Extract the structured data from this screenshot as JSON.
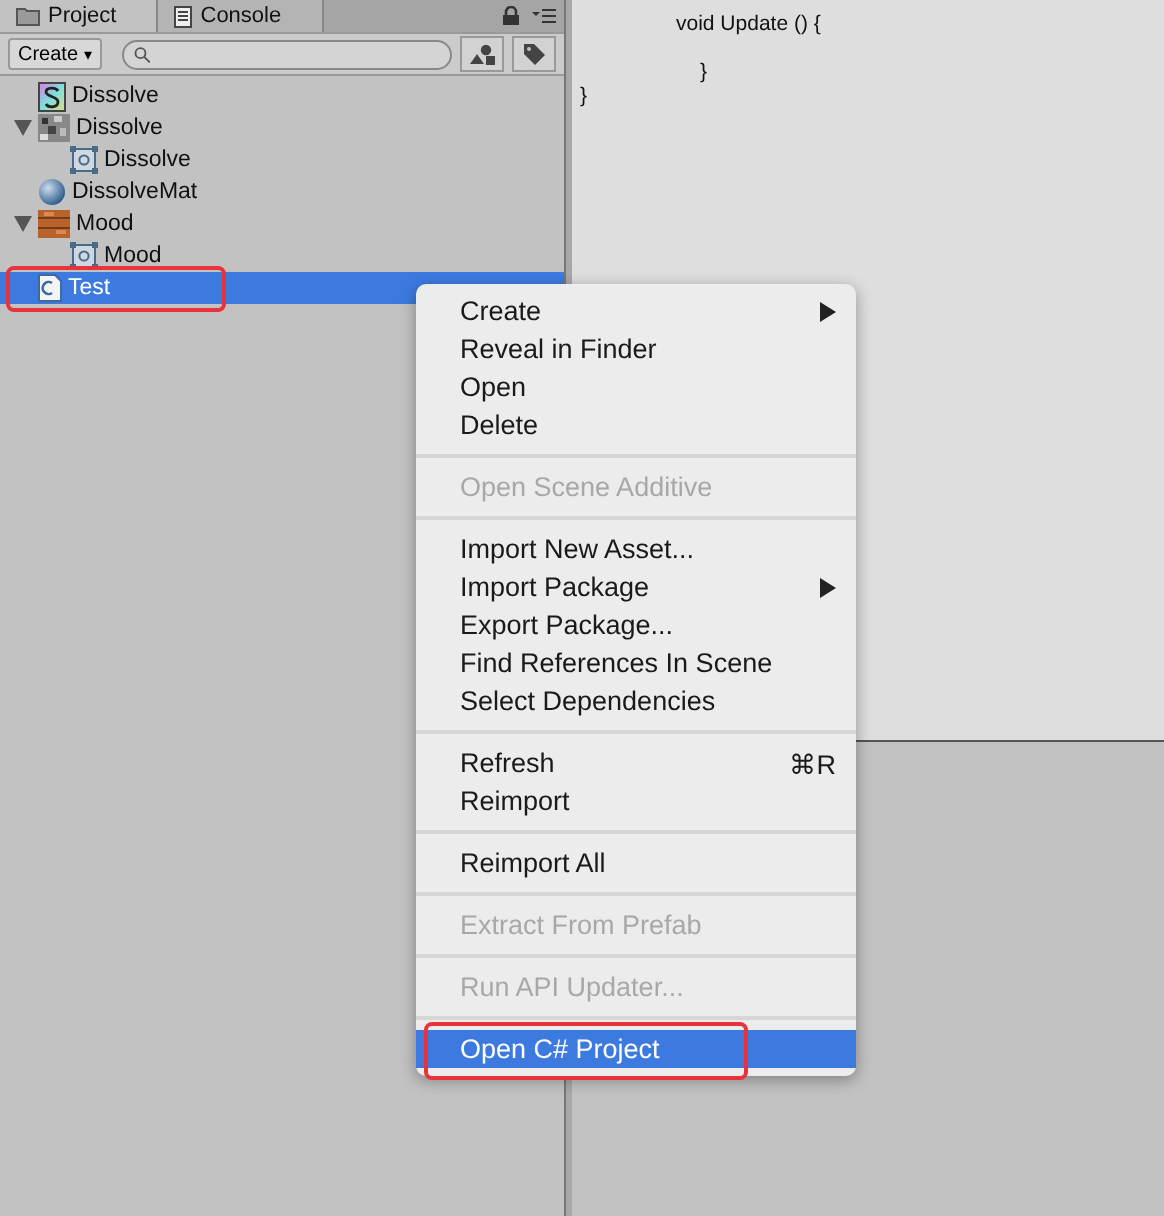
{
  "tabs": [
    {
      "label": "Project",
      "kind": "folder",
      "selected": true
    },
    {
      "label": "Console",
      "kind": "console",
      "selected": false
    }
  ],
  "toolbar": {
    "create": "Create",
    "caret": "▾"
  },
  "tree": [
    {
      "label": "Dissolve",
      "kind": "shader",
      "selected": false
    },
    {
      "label": "Dissolve",
      "kind": "texture",
      "expanded": true,
      "selected": false,
      "children": [
        {
          "label": "Dissolve",
          "kind": "sprite",
          "selected": false
        }
      ]
    },
    {
      "label": "DissolveMat",
      "kind": "material",
      "selected": false
    },
    {
      "label": "Mood",
      "kind": "wood",
      "expanded": true,
      "selected": false,
      "children": [
        {
          "label": "Mood",
          "kind": "sprite",
          "selected": false
        }
      ]
    },
    {
      "label": "Test",
      "kind": "script",
      "selected": true,
      "highlighted": true
    }
  ],
  "code": {
    "method": {
      "signature": "void Update () {",
      "closing": "}"
    },
    "class_closing": "}"
  },
  "menu": [
    [
      {
        "label": "Create",
        "disabled": false,
        "submenu": true,
        "selected": false
      },
      {
        "label": "Reveal in Finder",
        "disabled": false,
        "selected": false
      },
      {
        "label": "Open",
        "disabled": false,
        "selected": false
      },
      {
        "label": "Delete",
        "disabled": false,
        "selected": false
      }
    ],
    [
      {
        "label": "Open Scene Additive",
        "disabled": true,
        "selected": false
      }
    ],
    [
      {
        "label": "Import New Asset...",
        "disabled": false,
        "selected": false
      },
      {
        "label": "Import Package",
        "disabled": false,
        "submenu": true,
        "selected": false
      },
      {
        "label": "Export Package...",
        "disabled": false,
        "selected": false
      },
      {
        "label": "Find References In Scene",
        "disabled": false,
        "selected": false
      },
      {
        "label": "Select Dependencies",
        "disabled": false,
        "selected": false
      }
    ],
    [
      {
        "label": "Refresh",
        "shortcut": "⌘R",
        "disabled": false,
        "selected": false
      },
      {
        "label": "Reimport",
        "disabled": false,
        "selected": false
      }
    ],
    [
      {
        "label": "Reimport All",
        "disabled": false,
        "selected": false
      }
    ],
    [
      {
        "label": "Extract From Prefab",
        "disabled": true,
        "selected": false
      }
    ],
    [
      {
        "label": "Run API Updater...",
        "disabled": true,
        "selected": false
      }
    ],
    [
      {
        "label": "Open C# Project",
        "selected": true,
        "highlighted": true
      }
    ]
  ]
}
